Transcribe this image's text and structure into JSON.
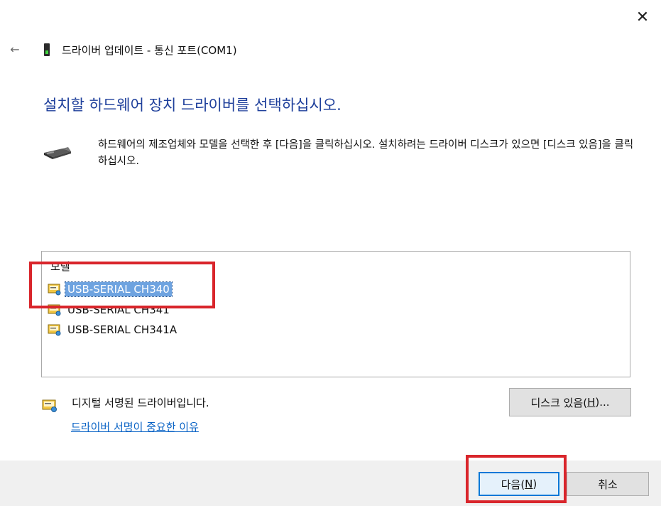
{
  "window": {
    "title": "드라이버 업데이트 - 통신 포트(COM1)",
    "close_glyph": "✕",
    "back_glyph": "←"
  },
  "main": {
    "heading": "설치할 하드웨어 장치 드라이버를 선택하십시오.",
    "description": "하드웨어의 제조업체와 모델을 선택한 후 [다음]을 클릭하십시오. 설치하려는 드라이버 디스크가 있으면 [디스크 있음]을 클릭하십시오."
  },
  "model_list": {
    "header": "모델",
    "items": [
      {
        "label": "USB-SERIAL CH340",
        "selected": true
      },
      {
        "label": "USB-SERIAL CH341",
        "selected": false
      },
      {
        "label": "USB-SERIAL CH341A",
        "selected": false
      }
    ]
  },
  "signature": {
    "status_text": "디지털 서명된 드라이버입니다.",
    "link_text": "드라이버 서명이 중요한 이유"
  },
  "buttons": {
    "have_disk_label": "디스크 있음(",
    "have_disk_mnemonic": "H",
    "have_disk_suffix": ")...",
    "next_label": "다음(",
    "next_mnemonic": "N",
    "next_suffix": ")",
    "cancel_label": "취소"
  },
  "colors": {
    "heading": "#1e3f9b",
    "link": "#0a63c5",
    "selection": "#6ea3e0",
    "annotation_red": "#d9252b",
    "default_button_border": "#0078d7"
  },
  "icons": {
    "back": "back-arrow-icon",
    "title": "com-port-icon",
    "hardware": "hardware-device-icon",
    "driver_item": "driver-package-icon",
    "signature": "signed-driver-icon",
    "close": "close-icon"
  }
}
